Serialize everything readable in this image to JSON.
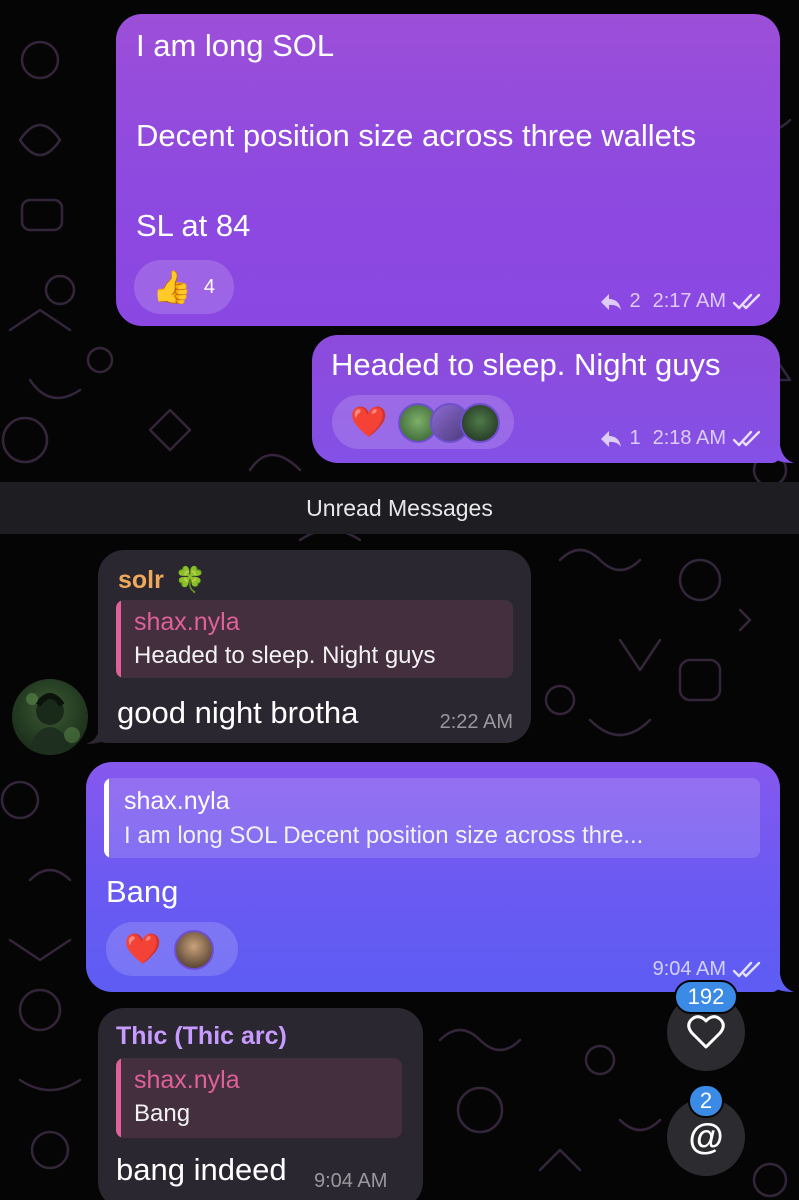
{
  "messages": [
    {
      "id": "msg1",
      "direction": "outgoing",
      "lines": [
        "I am long SOL",
        "Decent position size across three wallets",
        "SL at 84"
      ],
      "reaction": {
        "emoji": "👍",
        "count": "4"
      },
      "replies": "2",
      "time": "2:17 AM",
      "status": "read"
    },
    {
      "id": "msg2",
      "direction": "outgoing",
      "text": "Headed to sleep. Night guys",
      "reaction": {
        "emoji": "❤️"
      },
      "replies": "1",
      "time": "2:18 AM",
      "status": "read"
    },
    {
      "id": "msg3",
      "direction": "incoming",
      "sender": "solr",
      "sender_emoji": "🍀",
      "reply_to": {
        "author": "shax.nyla",
        "text": "Headed to sleep. Night guys"
      },
      "text": "good night brotha",
      "time": "2:22 AM"
    },
    {
      "id": "msg4",
      "direction": "outgoing",
      "reply_to": {
        "author": "shax.nyla",
        "text": "I am long SOL Decent position size across thre..."
      },
      "text": "Bang",
      "reaction": {
        "emoji": "❤️"
      },
      "time": "9:04 AM",
      "status": "read"
    },
    {
      "id": "msg5",
      "direction": "incoming",
      "sender": "Thic (Thic arc)",
      "reply_to": {
        "author": "shax.nyla",
        "text": "Bang"
      },
      "text": "bang indeed",
      "time": "9:04 AM"
    }
  ],
  "unread_label": "Unread Messages",
  "fabs": {
    "reactions_count": "192",
    "reactions_icon": "heart-outline-icon",
    "mentions_count": "2",
    "mentions_icon": "at-sign-icon"
  },
  "colors": {
    "outgoing_top": "#9c4fd8",
    "outgoing_bottom": "#5d5cf3",
    "incoming_bg": "#2a2730",
    "solr_name": "#f0a95a",
    "thic_name": "#c79bff",
    "reply_author": "#e0609a",
    "badge": "#3b8ae6"
  }
}
